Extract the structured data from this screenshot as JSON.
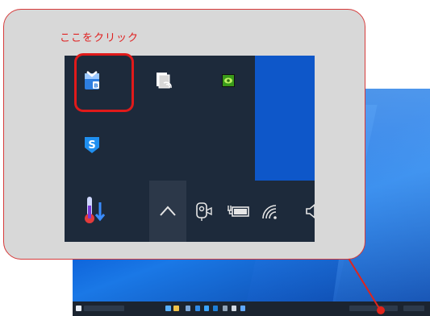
{
  "callout": {
    "instruction": "ここをクリック"
  },
  "tray_overflow_icons": [
    {
      "name": "backup-app-icon",
      "highlighted": true
    },
    {
      "name": "document-scanner-icon",
      "highlighted": false
    },
    {
      "name": "nvidia-icon",
      "highlighted": false
    },
    {
      "name": "security-shield-s-icon",
      "highlighted": false
    }
  ],
  "taskbar_icons": [
    "temperature-icon",
    "show-hidden-icons-chevron",
    "webcam-icon",
    "battery-icon",
    "wifi-icon",
    "volume-icon"
  ],
  "colors": {
    "callout_border": "#d63a3a",
    "highlight": "#e01a1a",
    "label": "#e02020",
    "taskbar": "#1d2a3b",
    "desktop": "#0b5ed7"
  }
}
